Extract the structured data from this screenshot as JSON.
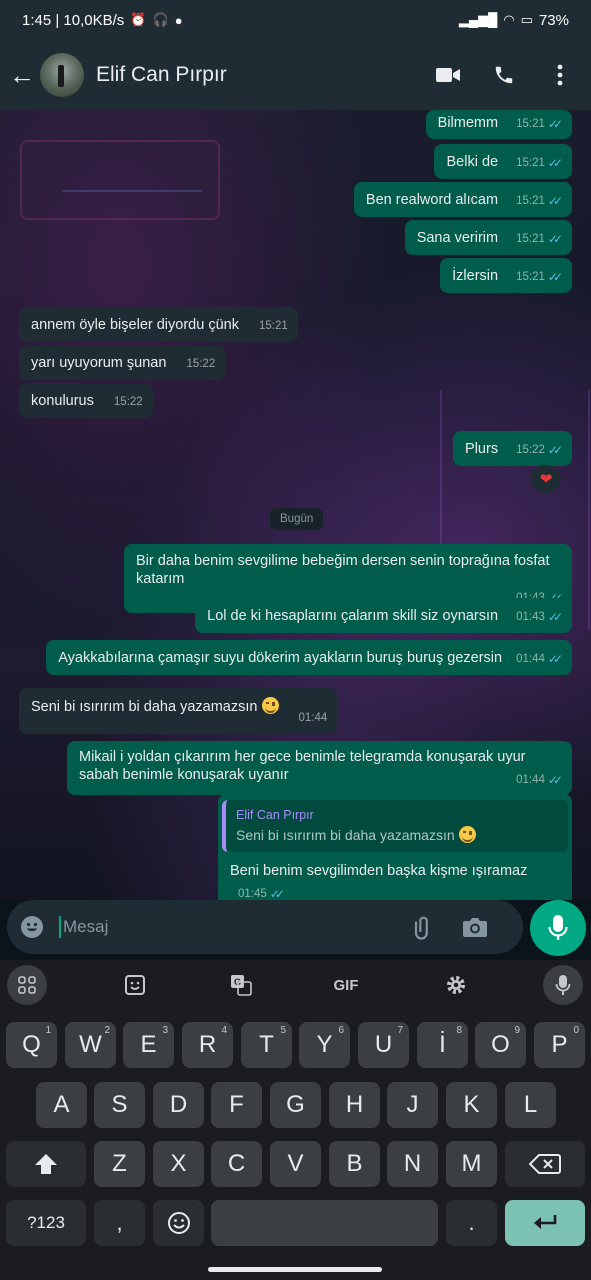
{
  "status_bar": {
    "time_speed": "1:45 | 10,0KB/s",
    "battery": "73%"
  },
  "header": {
    "contact_name": "Elif Can Pırpır"
  },
  "messages": [
    {
      "dir": "out",
      "text": "Bilmemm",
      "time": "15:21"
    },
    {
      "dir": "out",
      "text": "Belki de",
      "time": "15:21"
    },
    {
      "dir": "out",
      "text": "Ben realword alıcam",
      "time": "15:21"
    },
    {
      "dir": "out",
      "text": "Sana veririm",
      "time": "15:21"
    },
    {
      "dir": "out",
      "text": "İzlersin",
      "time": "15:21"
    },
    {
      "dir": "in",
      "text": "annem öyle bişeler diyordu çünk",
      "time": "15:21"
    },
    {
      "dir": "in",
      "text": "yarı uyuyorum şunan",
      "time": "15:22"
    },
    {
      "dir": "in",
      "text": "konulurus",
      "time": "15:22"
    },
    {
      "dir": "out",
      "text": "Plurs",
      "time": "15:22",
      "reaction": "❤"
    },
    {
      "dir": "out",
      "text": "Bir daha benim sevgilime bebeğim dersen senin toprağına fosfat katarım",
      "time": "01:43"
    },
    {
      "dir": "out",
      "text": "Lol de ki hesaplarını çalarım skill siz oynarsın",
      "time": "01:43"
    },
    {
      "dir": "out",
      "text": "Ayakkabılarına çamaşır suyu dökerim ayakların buruş buruş gezersin",
      "time": "01:44"
    },
    {
      "dir": "in",
      "text": "Seni bi ısırırım bi daha yazamazsın",
      "time": "01:44"
    },
    {
      "dir": "out",
      "text": "Mikail i yoldan çıkarırım her gece benimle telegramda konuşarak uyur sabah benimle konuşarak uyanır",
      "time": "01:44"
    },
    {
      "dir": "out",
      "text": "Beni benim sevgilimden başka kişme ışıramaz",
      "time": "01:45",
      "quote_name": "Elif Can Pırpır",
      "quote_text": "Seni bi ısırırım bi daha yazamazsın"
    }
  ],
  "date_divider": "Bugün",
  "composer": {
    "placeholder": "Mesaj"
  },
  "keyboard": {
    "toolbar_gif": "GIF",
    "row1": [
      "Q",
      "W",
      "E",
      "R",
      "T",
      "Y",
      "U",
      "İ",
      "O",
      "P"
    ],
    "row1_hints": [
      "1",
      "2",
      "3",
      "4",
      "5",
      "6",
      "7",
      "8",
      "9",
      "0"
    ],
    "row2": [
      "A",
      "S",
      "D",
      "F",
      "G",
      "H",
      "J",
      "K",
      "L"
    ],
    "row3": [
      "Z",
      "X",
      "C",
      "V",
      "B",
      "N",
      "M"
    ],
    "symbols_key": "?123",
    "comma_key": ",",
    "period_key": "."
  },
  "icons": {
    "back": "arrow-left-icon",
    "video": "video-call-icon",
    "call": "phone-icon",
    "menu": "more-vert-icon",
    "emoji": "emoji-icon",
    "attach": "paperclip-icon",
    "camera": "camera-icon",
    "mic": "microphone-icon"
  },
  "colors": {
    "outgoing_bubble": "#005c4b",
    "incoming_bubble": "#202c33",
    "accent": "#00a884",
    "read_ticks": "#53bdeb",
    "quote_accent": "#a78bfa"
  }
}
